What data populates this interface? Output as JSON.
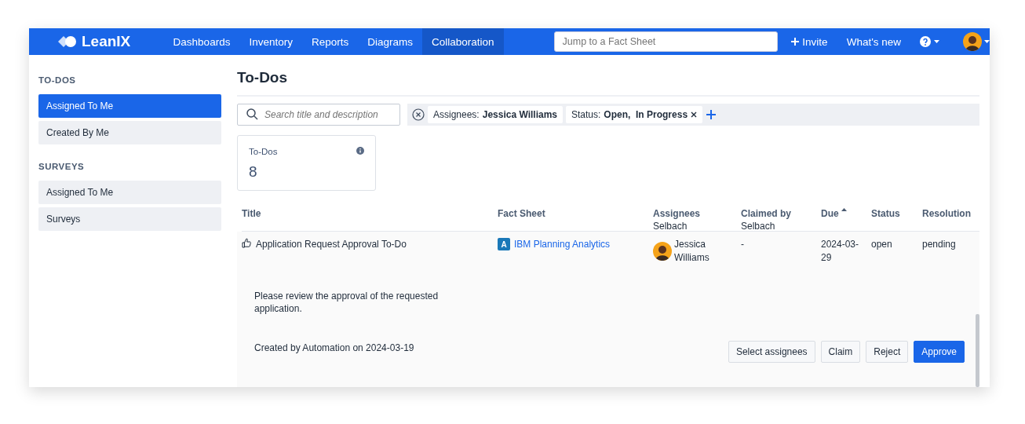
{
  "app": {
    "logo": "LeanIX"
  },
  "nav": [
    {
      "label": "Dashboards",
      "selected": false
    },
    {
      "label": "Inventory",
      "selected": false
    },
    {
      "label": "Reports",
      "selected": false
    },
    {
      "label": "Diagrams",
      "selected": false
    },
    {
      "label": "Collaboration",
      "selected": true
    }
  ],
  "global_search": {
    "placeholder": "Jump to a Fact Sheet"
  },
  "invite": "Invite",
  "whats_new": "What's new",
  "sidebar": [
    {
      "heading": "TO-DOS",
      "items": [
        {
          "label": "Assigned To Me",
          "selected": true
        },
        {
          "label": "Created By Me",
          "selected": false
        }
      ]
    },
    {
      "heading": "SURVEYS",
      "items": [
        {
          "label": "Assigned To Me",
          "selected": false
        },
        {
          "label": "Surveys",
          "selected": false
        }
      ]
    }
  ],
  "page_title": "To-Dos",
  "search": {
    "placeholder": "Search title and description"
  },
  "filters": [
    {
      "label": "Assignees:",
      "value": "Jessica Williams",
      "removable": false
    },
    {
      "label": "Status:",
      "value": "Open,  In Progress",
      "removable": true
    }
  ],
  "stat": {
    "label": "To-Dos",
    "value": "8"
  },
  "table": {
    "columns": [
      {
        "label": "Title",
        "sorted": false
      },
      {
        "label": "Fact Sheet",
        "sorted": false
      },
      {
        "label": "Assignees",
        "sorted": false
      },
      {
        "label": "Claimed by",
        "sorted": false
      },
      {
        "label": "Due",
        "sorted": true
      },
      {
        "label": "Status",
        "sorted": false
      },
      {
        "label": "Resolution",
        "sorted": false
      }
    ],
    "partial_row": {
      "assignees": "Selbach",
      "claimed_by": "Selbach"
    },
    "rows": [
      {
        "title": "Application Request Approval To-Do",
        "fact_sheet": {
          "type_letter": "A",
          "name": "IBM Planning Analytics"
        },
        "assignee": "Jessica Williams",
        "claimed_by": "-",
        "due": "2024-03-29",
        "status": "open",
        "resolution": "pending",
        "expanded": true,
        "description": "Please review the approval of the requested application.",
        "created": "Created by Automation on 2024-03-19",
        "actions": [
          {
            "label": "Select assignees",
            "kind": "secondary"
          },
          {
            "label": "Claim",
            "kind": "secondary"
          },
          {
            "label": "Reject",
            "kind": "secondary"
          },
          {
            "label": "Approve",
            "kind": "primary"
          }
        ]
      }
    ]
  }
}
